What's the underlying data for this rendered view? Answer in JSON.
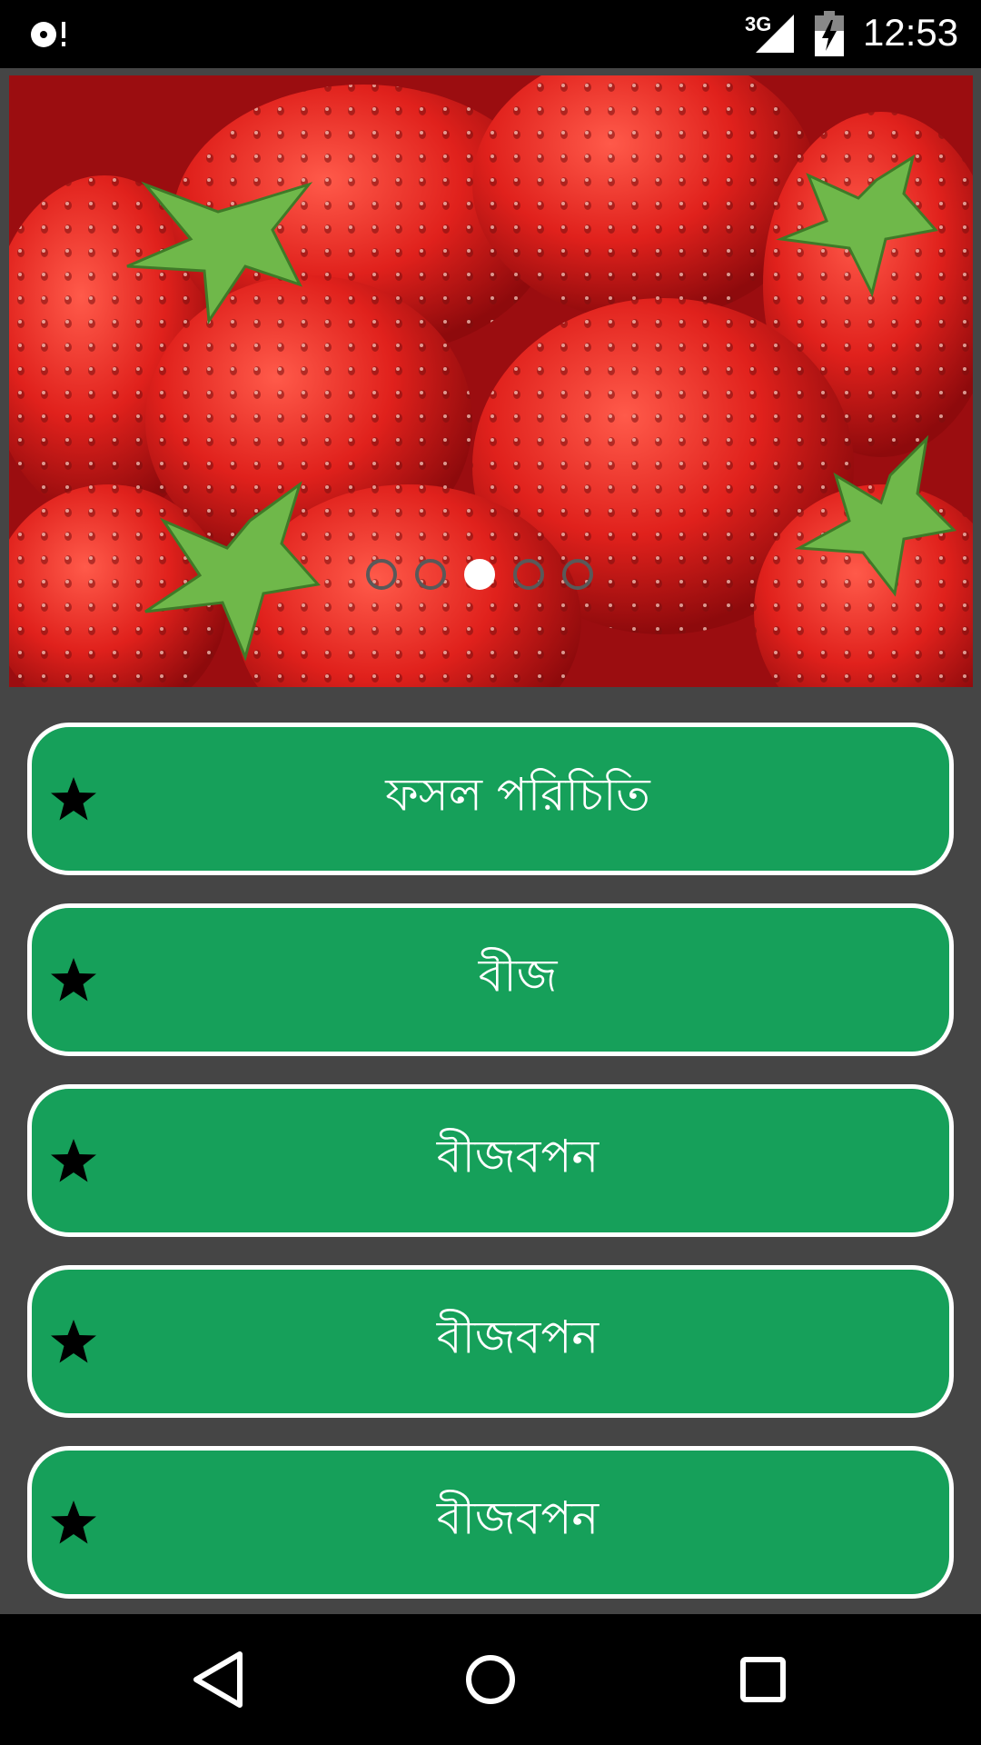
{
  "status_bar": {
    "network": "3G",
    "time": "12:53",
    "icons": [
      "record-icon",
      "signal-icon",
      "battery-charging-icon"
    ]
  },
  "banner": {
    "image": "strawberries-photo",
    "slide_count": 5,
    "active_slide": 3
  },
  "menu": {
    "items": [
      {
        "label": "ফসল পরিচিতি",
        "icon": "star-icon"
      },
      {
        "label": "বীজ",
        "icon": "star-icon"
      },
      {
        "label": "বীজবপন",
        "icon": "star-icon"
      },
      {
        "label": "বীজবপন",
        "icon": "star-icon"
      },
      {
        "label": "বীজবপন",
        "icon": "star-icon"
      }
    ]
  },
  "nav_bar": {
    "icons": [
      "back-icon",
      "home-icon",
      "recents-icon"
    ]
  },
  "colors": {
    "button_bg": "#16a05a",
    "page_bg": "#454545",
    "bar_bg": "#000000"
  }
}
